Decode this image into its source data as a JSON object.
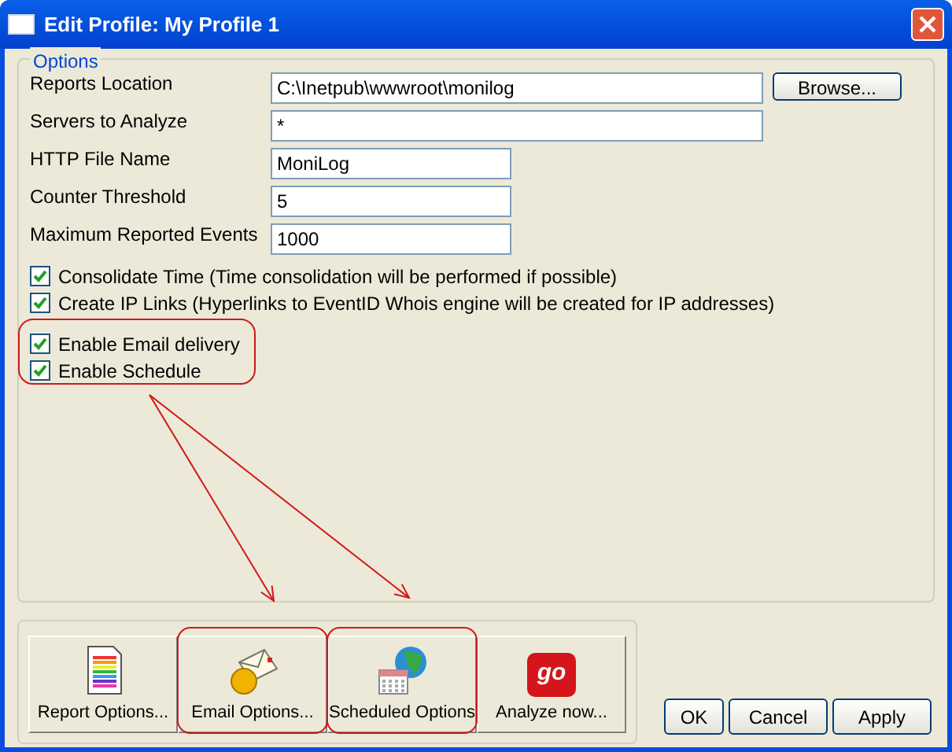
{
  "window": {
    "title": "Edit Profile: My Profile 1"
  },
  "options": {
    "legend": "Options",
    "fields": [
      {
        "label": "Reports Location",
        "value": "C:\\Inetpub\\wwwroot\\monilog",
        "wide": true,
        "browse": "Browse..."
      },
      {
        "label": "Servers to Analyze",
        "value": "*",
        "wide": true
      },
      {
        "label": "HTTP File Name",
        "value": "MoniLog",
        "wide": false
      },
      {
        "label": "Counter Threshold",
        "value": "5",
        "wide": false
      },
      {
        "label": "Maximum Reported Events",
        "value": "1000",
        "wide": false
      }
    ],
    "checkboxes": [
      {
        "label": "Consolidate Time (Time consolidation will be performed if possible)",
        "checked": true
      },
      {
        "label": "Create IP Links (Hyperlinks to EventID Whois engine will be created for IP addresses)",
        "checked": true
      }
    ],
    "highlighted_checkboxes": [
      {
        "label": "Enable Email delivery",
        "checked": true
      },
      {
        "label": "Enable Schedule",
        "checked": true
      }
    ]
  },
  "tool_buttons": [
    {
      "label": "Report Options...",
      "kind": "report",
      "highlighted": false
    },
    {
      "label": "Email Options...",
      "kind": "email",
      "highlighted": true
    },
    {
      "label": "Scheduled Options",
      "kind": "schedule",
      "highlighted": true
    },
    {
      "label": "Analyze now...",
      "kind": "go",
      "icon_text": "go",
      "highlighted": false
    }
  ],
  "buttons": [
    "OK",
    "Cancel",
    "Apply"
  ]
}
